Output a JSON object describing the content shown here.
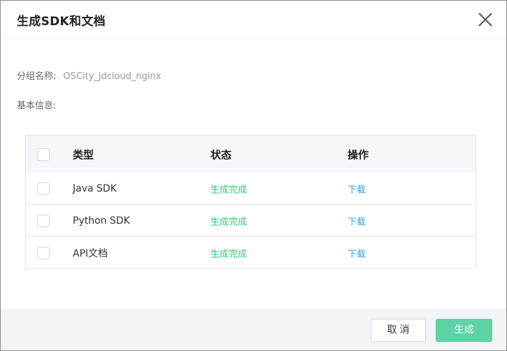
{
  "dialog": {
    "title": "生成SDK和文档",
    "close_icon": "close-icon"
  },
  "fields": {
    "group_label": "分组名称:",
    "group_value": "OSCity_jdcloud_nginx",
    "info_label": "基本信息:"
  },
  "table": {
    "headers": {
      "type": "类型",
      "status": "状态",
      "action": "操作"
    },
    "rows": [
      {
        "name": "Java SDK",
        "status": "生成完成",
        "action": "下载"
      },
      {
        "name": "Python SDK",
        "status": "生成完成",
        "action": "下载"
      },
      {
        "name": "API文档",
        "status": "生成完成",
        "action": "下载"
      }
    ]
  },
  "footer": {
    "cancel_label": "取消",
    "generate_label": "生成"
  },
  "colors": {
    "status_success": "#2ecc71",
    "link": "#3b9fdf",
    "primary_button": "#5fd3a5"
  }
}
